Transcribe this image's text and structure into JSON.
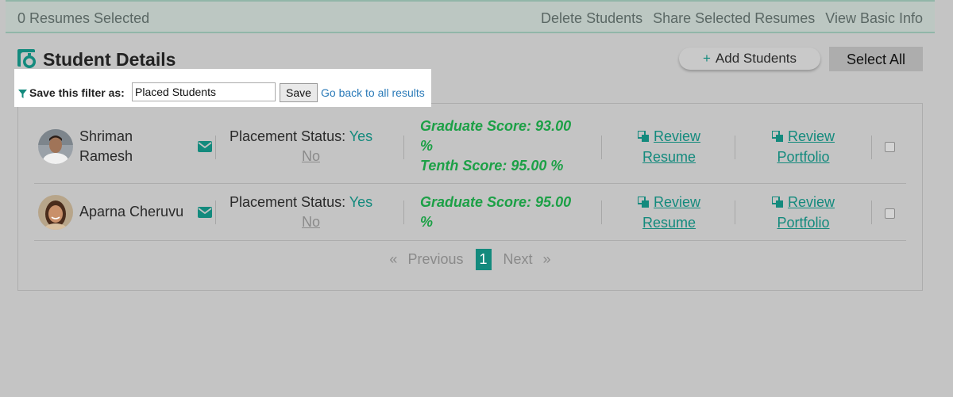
{
  "topbar": {
    "selected_text": "0 Resumes Selected",
    "actions": [
      "Delete Students",
      "Share Selected Resumes",
      "View Basic Info"
    ]
  },
  "header": {
    "title": "Student Details",
    "title_icon": "stopwatch-icon",
    "add_label": "Add Students",
    "add_icon": "+",
    "select_all_label": "Select All"
  },
  "filter": {
    "label": "Save this filter as:",
    "value": "Placed Students",
    "save_label": "Save",
    "back_label": "Go back to all results"
  },
  "students": [
    {
      "first": "Shriman",
      "last": "Ramesh",
      "status_label": "Placement Status:",
      "yes": "Yes",
      "no": "No",
      "grad_score": "Graduate Score: 93.00",
      "grad_suffix": "%",
      "tenth_score": "Tenth Score: 95.00 %",
      "review_resume_1": "Review",
      "review_resume_2": "Resume",
      "review_portfolio_1": "Review",
      "review_portfolio_2": "Portfolio"
    },
    {
      "name": "Aparna Cheruvu",
      "status_label": "Placement Status:",
      "yes": "Yes",
      "no": "No",
      "grad_score": "Graduate Score: 95.00",
      "grad_suffix": "%",
      "review_resume_1": "Review",
      "review_resume_2": "Resume",
      "review_portfolio_1": "Review",
      "review_portfolio_2": "Portfolio"
    }
  ],
  "pager": {
    "prev_arrow": "«",
    "prev": "Previous",
    "current": "1",
    "next": "Next",
    "next_arrow": "»"
  },
  "colors": {
    "accent": "#138a7d",
    "score": "#1ca046",
    "link": "#2a7ab8"
  }
}
